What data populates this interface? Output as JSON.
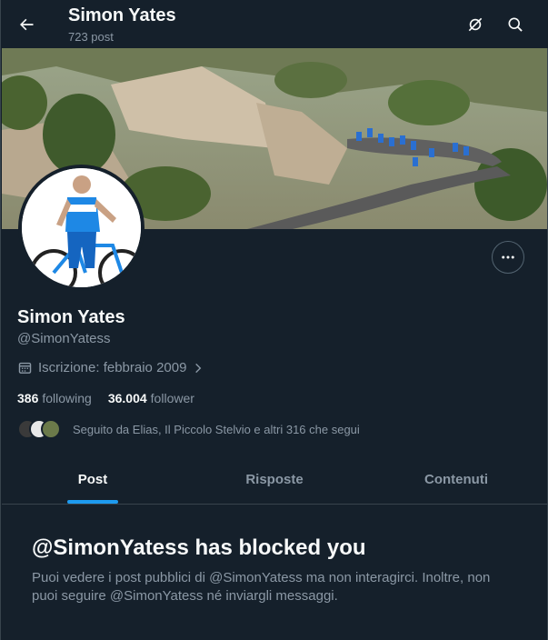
{
  "header": {
    "title": "Simon Yates",
    "subtitle": "723 post",
    "icons": [
      "back-arrow-icon",
      "grok-icon",
      "search-icon"
    ]
  },
  "profile": {
    "name": "Simon Yates",
    "handle": "@SimonYatess",
    "joined": "Iscrizione: febbraio 2009",
    "following_count": "386",
    "following_label": "following",
    "followers_count": "36.004",
    "followers_label": "follower",
    "followed_by": "Seguito da Elias, Il Piccolo Stelvio e altri 316 che segui"
  },
  "tabs": [
    {
      "label": "Post",
      "active": true
    },
    {
      "label": "Risposte",
      "active": false
    },
    {
      "label": "Contenuti",
      "active": false
    }
  ],
  "blocked": {
    "title": "@SimonYatess has blocked you",
    "body": "Puoi vedere i post pubblici di @SimonYatess ma non interagirci. Inoltre, non puoi seguire @SimonYatess né inviargli messaggi."
  },
  "colors": {
    "background": "#15202b",
    "accent": "#1d9bf0",
    "text_primary": "#f7f9f9",
    "text_secondary": "#8b98a5"
  }
}
